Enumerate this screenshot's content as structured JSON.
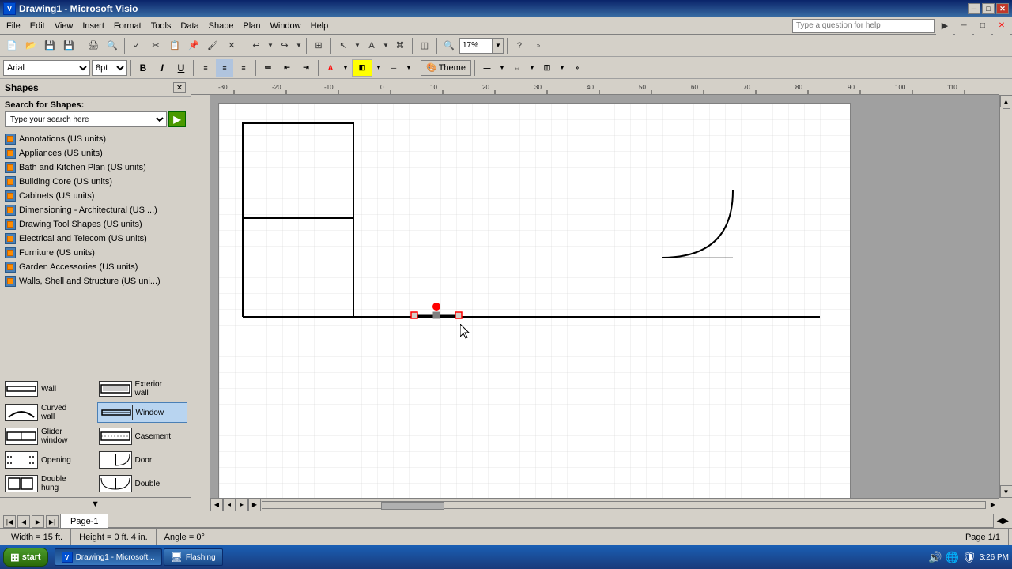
{
  "titleBar": {
    "title": "Drawing1 - Microsoft Visio",
    "minBtn": "─",
    "maxBtn": "□",
    "closeBtn": "✕"
  },
  "menu": {
    "items": [
      "File",
      "Edit",
      "View",
      "Insert",
      "Format",
      "Tools",
      "Data",
      "Shape",
      "Plan",
      "Window",
      "Help"
    ]
  },
  "toolbar1": {
    "zoomLevel": "17%",
    "helpPlaceholder": "Type a question for help"
  },
  "toolbar2": {
    "fontName": "Arial",
    "fontSize": "8pt",
    "boldLabel": "B",
    "italicLabel": "I",
    "underlineLabel": "U",
    "themeLabel": "Theme"
  },
  "sidebar": {
    "title": "Shapes",
    "searchLabel": "Search for Shapes:",
    "searchPlaceholder": "Type your search here",
    "searchGoLabel": "▶",
    "categories": [
      "Annotations (US units)",
      "Appliances (US units)",
      "Bath and Kitchen Plan (US units)",
      "Building Core (US units)",
      "Cabinets (US units)",
      "Dimensioning - Architectural (US ...)",
      "Drawing Tool Shapes (US units)",
      "Electrical and Telecom (US units)",
      "Furniture (US units)",
      "Garden Accessories (US units)",
      "Walls, Shell and Structure (US uni..."
    ],
    "shapeTemplates": [
      {
        "label": "Wall",
        "type": "wall"
      },
      {
        "label": "Exterior wall",
        "type": "ext-wall"
      },
      {
        "label": "Curved wall",
        "type": "curved-wall"
      },
      {
        "label": "Window",
        "type": "window",
        "selected": true
      },
      {
        "label": "Glider window",
        "type": "glider"
      },
      {
        "label": "Casement",
        "type": "casement"
      },
      {
        "label": "Opening",
        "type": "opening"
      },
      {
        "label": "Door",
        "type": "door"
      },
      {
        "label": "Double hung",
        "type": "dbl-hung"
      },
      {
        "label": "Double",
        "type": "double"
      }
    ]
  },
  "canvas": {
    "gridColor": "#d0d0d0",
    "backgroundColor": "white"
  },
  "pageTabs": {
    "tabs": [
      "Page-1"
    ],
    "activeTab": "Page-1"
  },
  "statusBar": {
    "width": "Width = 15 ft.",
    "height": "Height = 0 ft. 4 in.",
    "angle": "Angle = 0°",
    "page": "Page 1/1"
  },
  "taskbar": {
    "startLabel": "start",
    "items": [
      {
        "label": "Drawing1 - Microsoft...",
        "icon": "visio"
      },
      {
        "label": "Flashing",
        "icon": "monitor"
      }
    ],
    "clock": "3:26 PM"
  }
}
